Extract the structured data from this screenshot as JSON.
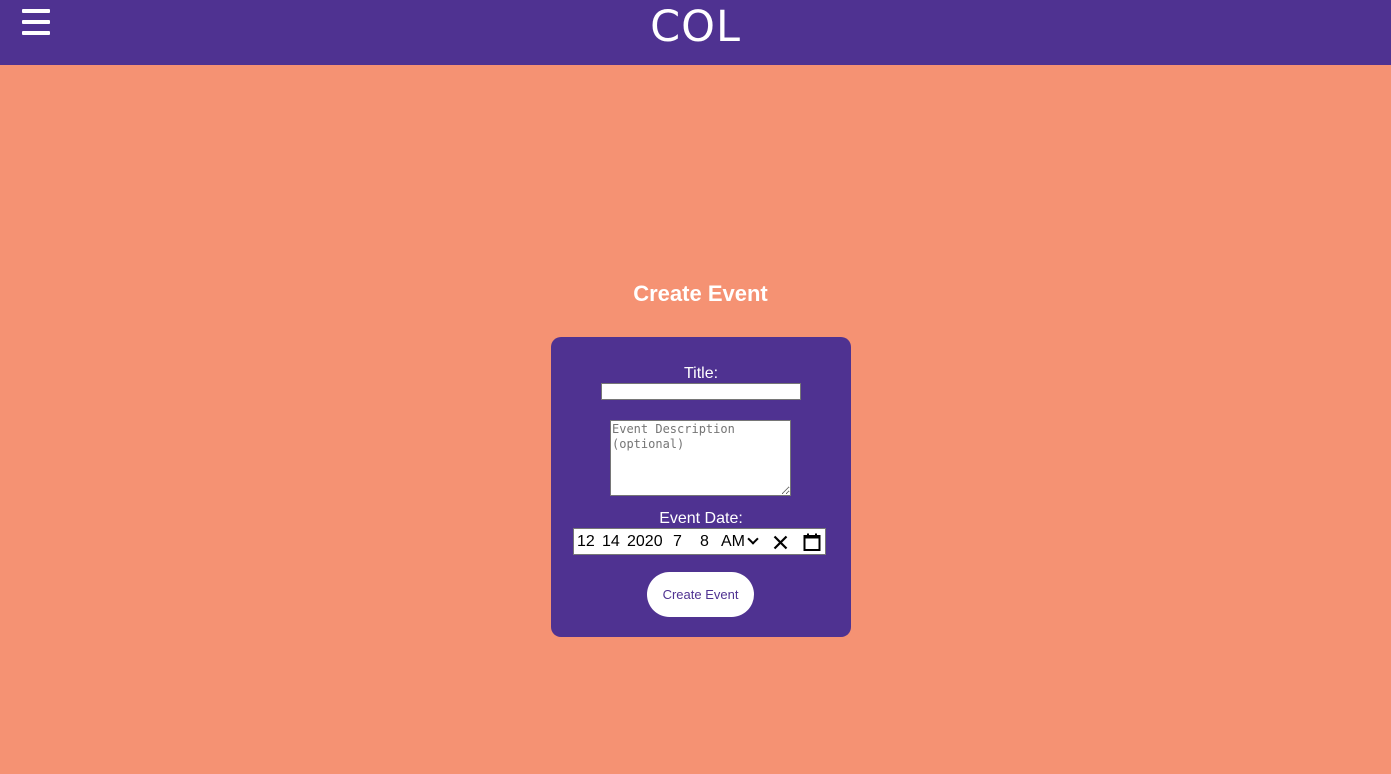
{
  "header": {
    "logo_text": "COL",
    "menu_icon": "hamburger-menu-icon",
    "background_color": "#4F3291"
  },
  "page": {
    "background_color": "#F59273",
    "title": "Create Event"
  },
  "form": {
    "title_label": "Title:",
    "title_value": "",
    "description_placeholder": "Event Description (optional)",
    "date_label": "Event Date:",
    "date_value": {
      "month": "12",
      "day": "14",
      "year": "2020",
      "hour": "7",
      "minute": "8",
      "ampm": "AM"
    },
    "clear_icon": "clear-x-icon",
    "calendar_icon": "calendar-icon",
    "submit_label": "Create Event",
    "card_color": "#4F3291"
  }
}
